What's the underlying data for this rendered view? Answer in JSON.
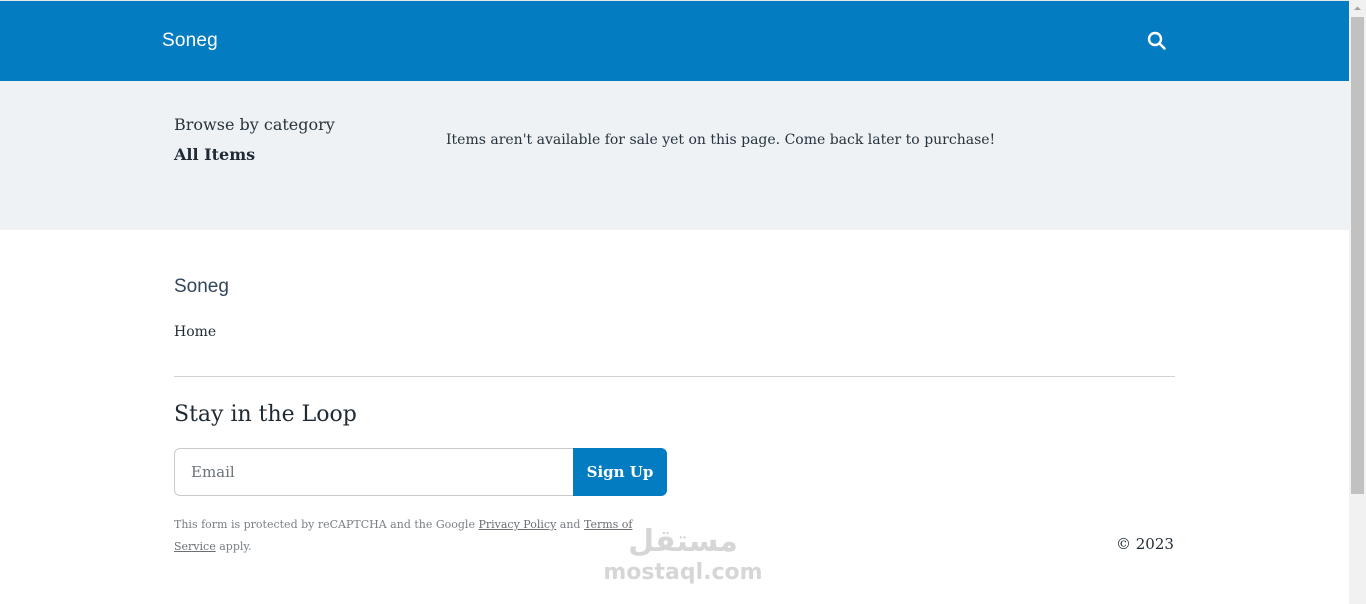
{
  "header": {
    "brand": "Soneg",
    "search_icon": "search-icon",
    "background_color": "#047cc2"
  },
  "category": {
    "browse_label": "Browse by category",
    "all_items_label": "All Items",
    "notice": "Items aren't available for sale yet on this page. Come back later to purchase!",
    "background_color": "#eef2f5"
  },
  "footer": {
    "brand": "Soneg",
    "home_link": "Home",
    "newsletter_title": "Stay in the Loop",
    "email_placeholder": "Email",
    "email_value": "",
    "signup_label": "Sign Up",
    "legal_prefix": "This form is protected by reCAPTCHA and the Google ",
    "privacy_link": "Privacy Policy",
    "legal_and": " and ",
    "terms_link": "Terms of Service",
    "legal_suffix": " apply.",
    "copyright": "© 2023"
  },
  "watermark": {
    "arabic": "مستقل",
    "latin": "mostaql.com"
  }
}
